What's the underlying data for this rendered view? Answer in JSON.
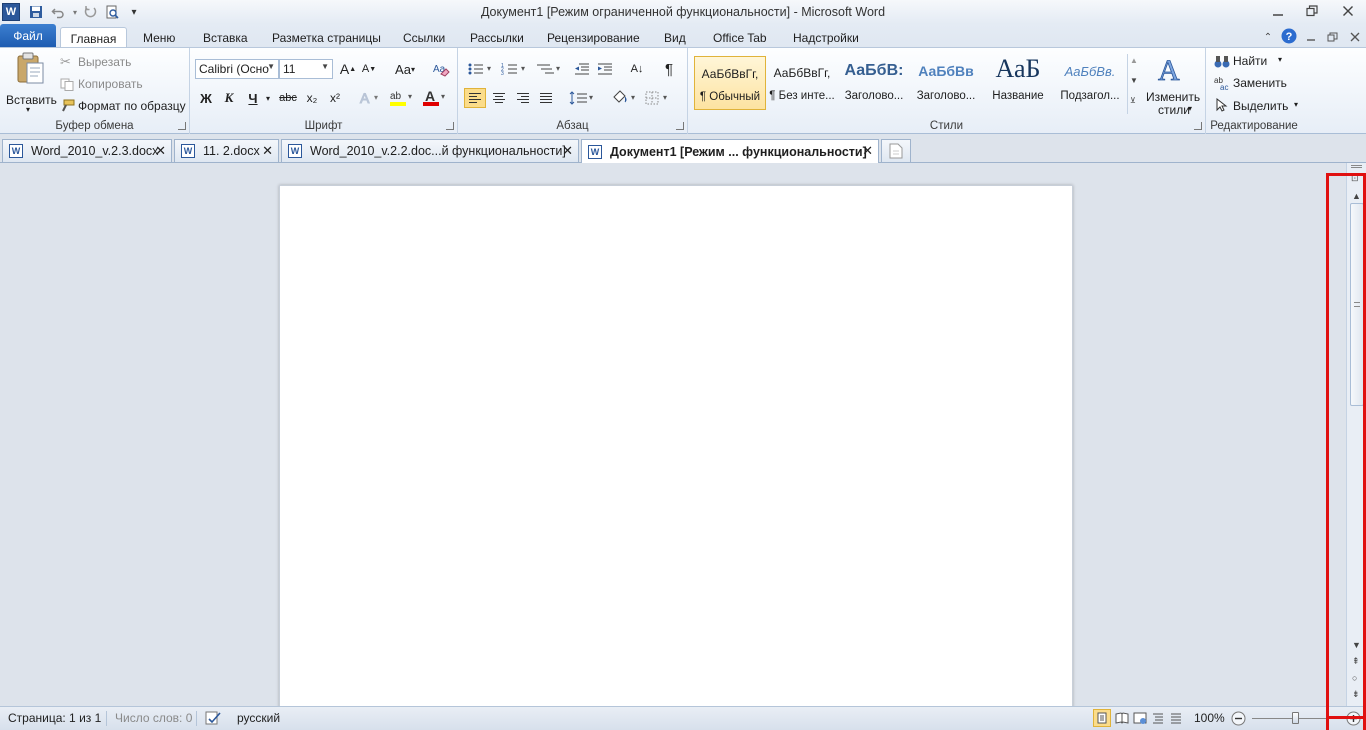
{
  "window": {
    "title": "Документ1 [Режим ограниченной функциональности]  -  Microsoft Word",
    "app_icon": "W"
  },
  "quick_access": [
    "save-icon",
    "undo-icon",
    "redo-icon",
    "print-preview-icon",
    "customize-icon"
  ],
  "ribbon_tabs": {
    "file": "Файл",
    "home": "Главная",
    "menu": "Меню",
    "insert": "Вставка",
    "page_layout": "Разметка страницы",
    "references": "Ссылки",
    "mailings": "Рассылки",
    "review": "Рецензирование",
    "view": "Вид",
    "office_tab": "Office Tab",
    "addins": "Надстройки"
  },
  "clipboard": {
    "paste": "Вставить",
    "cut": "Вырезать",
    "copy": "Копировать",
    "format_painter": "Формат по образцу",
    "label": "Буфер обмена"
  },
  "font": {
    "name": "Calibri (Осно",
    "size": "11",
    "grow": "A",
    "shrink": "A",
    "change_case": "Aa",
    "bold": "Ж",
    "italic": "К",
    "underline": "Ч",
    "strike": "abc",
    "subscript": "x₂",
    "superscript": "x²",
    "highlight_letters": "ab",
    "color_letter": "A",
    "label": "Шрифт"
  },
  "paragraph": {
    "sort": "А↓",
    "pilcrow": "¶",
    "label": "Абзац"
  },
  "styles": {
    "items": [
      {
        "sample": "АаБбВвГг,",
        "name": "¶ Обычный"
      },
      {
        "sample": "АаБбВвГг,",
        "name": "¶ Без инте..."
      },
      {
        "sample": "АаБбВ:",
        "name": "Заголово..."
      },
      {
        "sample": "АаБбВв",
        "name": "Заголово..."
      },
      {
        "sample": "АаБ",
        "name": "Название"
      },
      {
        "sample": "АаБбВв.",
        "name": "Подзагол..."
      }
    ],
    "change_styles": "Изменить",
    "change_styles_2": "стили",
    "label": "Стили"
  },
  "editing": {
    "find": "Найти",
    "replace": "Заменить",
    "select": "Выделить",
    "label": "Редактирование"
  },
  "doc_tabs": [
    {
      "label": "Word_2010_v.2.3.docx"
    },
    {
      "label": "11. 2.docx"
    },
    {
      "label": "Word_2010_v.2.2.doc...й функциональности]"
    },
    {
      "label": "Документ1 [Режим ... функциональности]"
    }
  ],
  "status": {
    "page": "Страница: 1 из 1",
    "words": "Число слов: 0",
    "language": "русский",
    "zoom": "100%"
  },
  "zoom_level_percent": 100,
  "highlight_color": "#e01010"
}
